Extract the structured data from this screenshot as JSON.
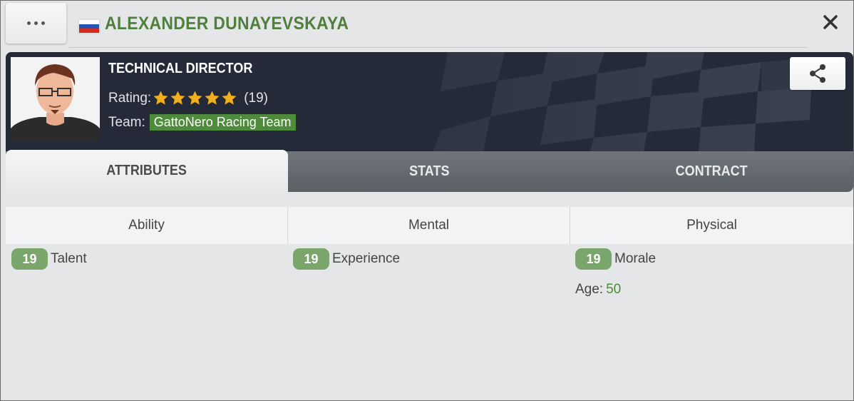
{
  "header": {
    "menu_icon": "more-horizontal-icon",
    "flag": "russia",
    "flag_colors": [
      "#ffffff",
      "#2456b8",
      "#d52b1e"
    ],
    "title": "ALEXANDER DUNAYEVSKAYA",
    "close_icon": "close-icon"
  },
  "profile": {
    "role": "TECHNICAL DIRECTOR",
    "rating_label": "Rating:",
    "stars": 5,
    "rating_count": "(19)",
    "team_label": "Team:",
    "team_name": "GattoNero Racing Team",
    "share_icon": "share-icon"
  },
  "tabs": [
    {
      "label": "ATTRIBUTES",
      "active": true
    },
    {
      "label": "STATS",
      "active": false
    },
    {
      "label": "CONTRACT",
      "active": false
    }
  ],
  "attributes": {
    "columns": [
      "Ability",
      "Mental",
      "Physical"
    ],
    "items": [
      {
        "value": "19",
        "label": "Talent"
      },
      {
        "value": "19",
        "label": "Experience"
      },
      {
        "value": "19",
        "label": "Morale"
      }
    ],
    "age_label": "Age:",
    "age_value": "50"
  },
  "colors": {
    "accent_green": "#4e7f3c",
    "badge_green": "#7aa56b",
    "banner_bg": "#242a38",
    "star": "#f2b01e"
  }
}
